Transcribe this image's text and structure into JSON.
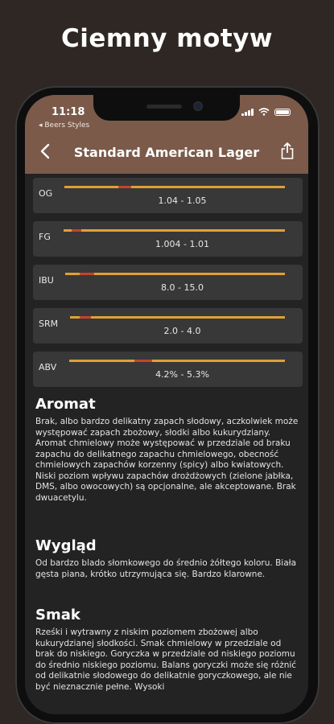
{
  "promo": {
    "title": "Ciemny motyw"
  },
  "status_bar": {
    "time": "11:18",
    "back_app": "◂ Beers Styles"
  },
  "nav": {
    "title": "Standard American Lager"
  },
  "colors": {
    "header": "#7b5a4a",
    "track": "#e0a035",
    "marker": "#c5442b",
    "card": "#383838",
    "background": "#232323"
  },
  "metrics": [
    {
      "label": "OG",
      "range": "1.04 - 1.05"
    },
    {
      "label": "FG",
      "range": "1.004 - 1.01"
    },
    {
      "label": "IBU",
      "range": "8.0 - 15.0"
    },
    {
      "label": "SRM",
      "range": "2.0 - 4.0"
    },
    {
      "label": "ABV",
      "range": "4.2% - 5.3%"
    }
  ],
  "sections": [
    {
      "title": "Aromat",
      "body": "Brak, albo bardzo delikatny zapach słodowy, aczkolwiek może występować zapach zbożowy, słodki albo kukurydziany. Aromat chmielowy może występować w przedziale od braku zapachu do delikatnego zapachu chmielowego, obecność chmielowych zapachów korzenny (spicy) albo kwiatowych. Niski poziom wpływu zapachów drożdżowych (zielone jabłka, DMS, albo owocowych) są opcjonalne, ale akceptowane. Brak dwuacetylu."
    },
    {
      "title": "Wygląd",
      "body": "Od bardzo blado słomkowego do średnio żółtego koloru. Biała gęsta piana, krótko utrzymująca się. Bardzo klarowne."
    },
    {
      "title": "Smak",
      "body": "Rześki i wytrawny z niskim poziomem zbożowej albo kukurydzianej słodkości. Smak chmielowy w przedziale od brak do niskiego. Goryczka w przedziale od niskiego poziomu do średnio niskiego poziomu. Balans goryczki może się różnić od delikatnie słodowego do delikatnie goryczkowego, ale nie być nieznacznie pełne. Wysoki"
    }
  ]
}
